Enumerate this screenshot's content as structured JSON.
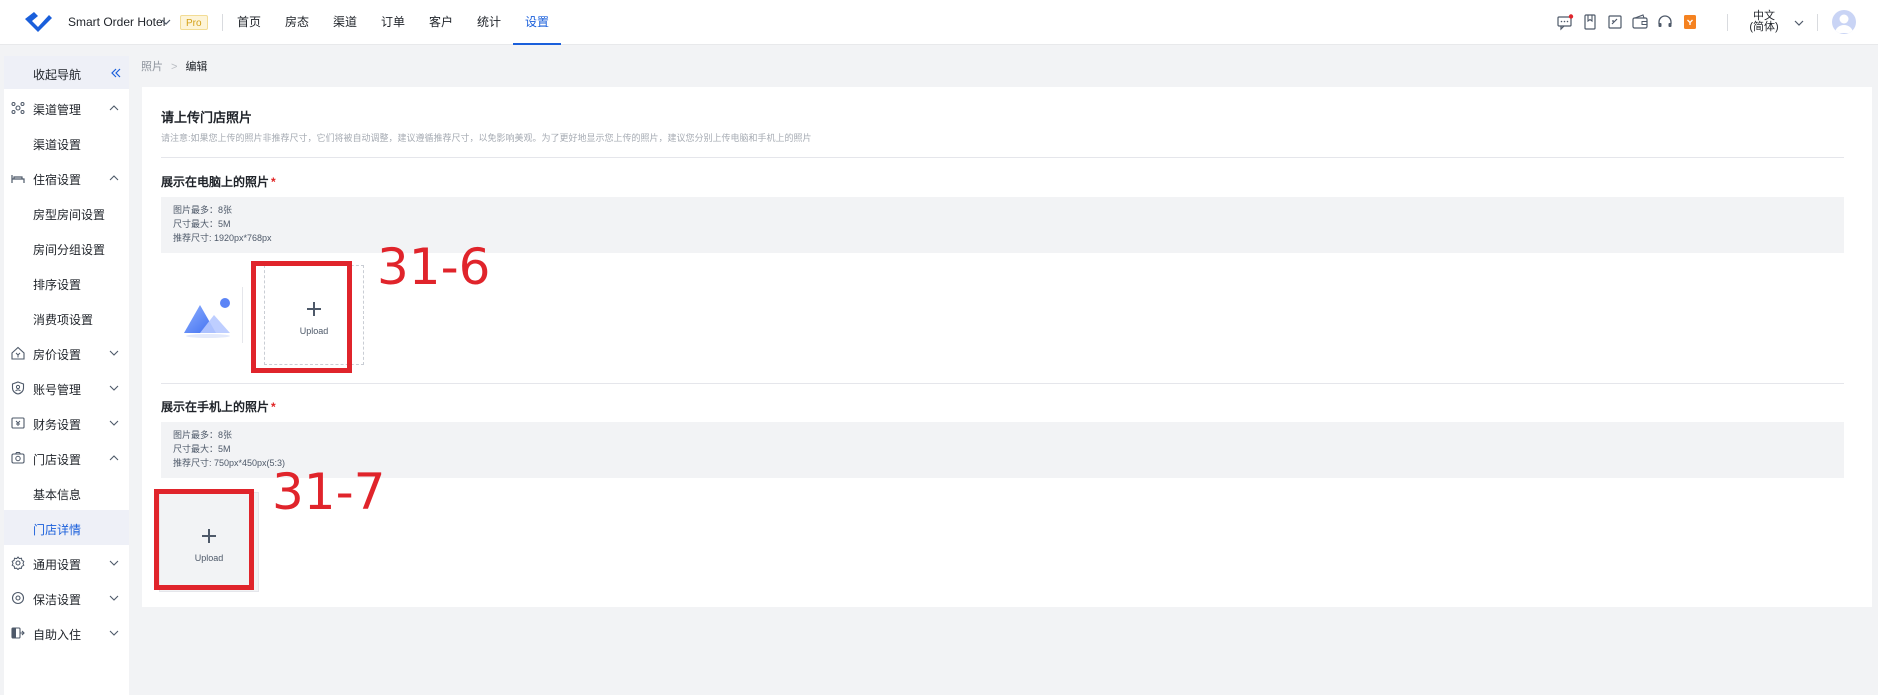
{
  "header": {
    "hotel_name": "Smart Order Hotel",
    "pro_badge": "Pro",
    "nav": [
      {
        "label": "首页"
      },
      {
        "label": "房态"
      },
      {
        "label": "渠道"
      },
      {
        "label": "订单"
      },
      {
        "label": "客户"
      },
      {
        "label": "统计"
      },
      {
        "label": "设置",
        "active": true
      }
    ],
    "icons": [
      "message-icon",
      "bookmark-icon",
      "edit-note-icon",
      "wallet-icon",
      "headset-icon",
      "pin-icon"
    ],
    "lang_line1": "中文",
    "lang_line2": "(简体)"
  },
  "sidebar": {
    "collapse_label": "收起导航",
    "items": [
      {
        "label": "渠道管理",
        "icon": "channel-icon",
        "expanded": true
      },
      {
        "label": "渠道设置"
      },
      {
        "label": "住宿设置",
        "icon": "bed-icon",
        "expanded": true
      },
      {
        "label": "房型房间设置"
      },
      {
        "label": "房间分组设置"
      },
      {
        "label": "排序设置"
      },
      {
        "label": "消费项设置"
      },
      {
        "label": "房价设置",
        "icon": "house-price-icon",
        "expanded": false
      },
      {
        "label": "账号管理",
        "icon": "account-shield-icon",
        "expanded": false
      },
      {
        "label": "财务设置",
        "icon": "finance-icon",
        "expanded": false
      },
      {
        "label": "门店设置",
        "icon": "store-camera-icon",
        "expanded": true
      },
      {
        "label": "基本信息"
      },
      {
        "label": "门店详情",
        "active": true
      },
      {
        "label": "通用设置",
        "icon": "gear-icon",
        "expanded": false
      },
      {
        "label": "保洁设置",
        "icon": "cleaning-icon",
        "expanded": false
      },
      {
        "label": "自助入住",
        "icon": "self-checkin-icon",
        "expanded": false
      }
    ]
  },
  "breadcrumb": {
    "parent": "照片",
    "sep": ">",
    "current": "编辑"
  },
  "main": {
    "title": "请上传门店照片",
    "note": "请注意:如果您上传的照片非推荐尺寸，它们将被自动调整，建议遵循推荐尺寸，以免影响美观。为了更好地显示您上传的照片，建议您分别上传电脑和手机上的照片",
    "pc_section": {
      "title": "展示在电脑上的照片",
      "required_mark": "*",
      "info": [
        "图片最多：8张",
        "尺寸最大：5M",
        "推荐尺寸: 1920px*768px"
      ],
      "upload_label": "Upload",
      "annotation": "31-6"
    },
    "mobile_section": {
      "title": "展示在手机上的照片",
      "required_mark": "*",
      "info": [
        "图片最多：8张",
        "尺寸最大：5M",
        "推荐尺寸: 750px*450px(5:3)"
      ],
      "upload_label": "Upload",
      "annotation": "31-7"
    }
  },
  "colors": {
    "accent": "#1a5fdb",
    "annotation_red": "#e0242b",
    "required": "#e02424"
  }
}
